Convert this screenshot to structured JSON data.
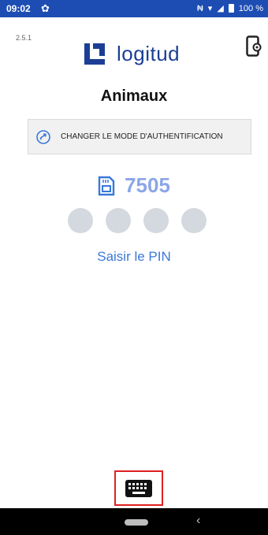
{
  "status_bar": {
    "time": "09:02",
    "battery_percent": "100 %"
  },
  "app": {
    "version": "2.5.1",
    "logo_text": "logitud",
    "title": "Animaux"
  },
  "auth_button": {
    "label": "CHANGER LE MODE D'AUTHENTIFICATION"
  },
  "card": {
    "number": "7505"
  },
  "pin": {
    "dot_count": 4,
    "link_label": "Saisir le PIN"
  },
  "colors": {
    "status_bar": "#1d4db3",
    "brand": "#1c3f95",
    "accent": "#3a78d8",
    "card_number": "#8ba6e8",
    "pin_dot": "#d4d9e0",
    "highlight": "#e02020"
  },
  "icons": {
    "status_settings": "gear-icon",
    "signal": "wifi-icon",
    "battery": "battery-icon",
    "settings_phone": "phone-settings-icon",
    "auth": "swap-icon",
    "card": "sim-card-icon",
    "keyboard": "keyboard-icon"
  }
}
